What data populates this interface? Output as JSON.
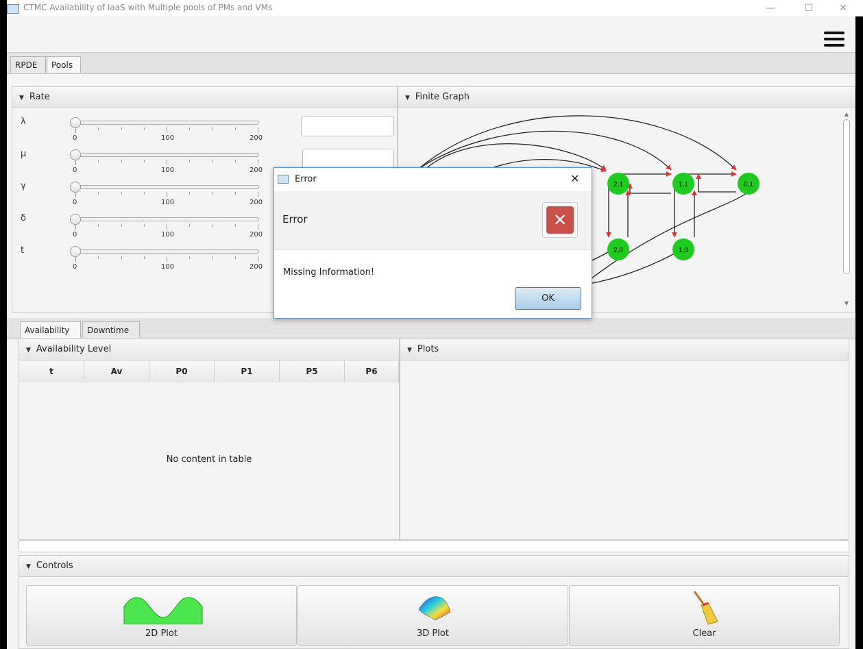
{
  "window": {
    "title": "CTMC Availability of IaaS with Multiple pools of PMs and VMs",
    "min_icon": "minimize-icon",
    "max_icon": "maximize-icon",
    "close_icon": "close-icon"
  },
  "menu": {
    "icon": "hamburger-menu-icon"
  },
  "top_tabs": [
    {
      "label": "RPDE",
      "selected": false
    },
    {
      "label": "Pools",
      "selected": true
    }
  ],
  "rate_panel": {
    "title": "Rate",
    "sliders": [
      {
        "symbol": "λ",
        "min": "0",
        "mid": "100",
        "max": "200",
        "value": 0
      },
      {
        "symbol": "μ",
        "min": "0",
        "mid": "100",
        "max": "200",
        "value": 0
      },
      {
        "symbol": "γ",
        "min": "0",
        "mid": "100",
        "max": "200",
        "value": 0
      },
      {
        "symbol": "δ",
        "min": "0",
        "mid": "100",
        "max": "200",
        "value": 0
      },
      {
        "symbol": "t",
        "min": "0",
        "mid": "100",
        "max": "200",
        "value": 0
      }
    ]
  },
  "graph_panel": {
    "title": "Finite Graph",
    "nodes": [
      {
        "label": "2,1"
      },
      {
        "label": "1,1"
      },
      {
        "label": "0,1"
      },
      {
        "label": "2,0"
      },
      {
        "label": "1,0"
      }
    ]
  },
  "bottom_tabs": [
    {
      "label": "Availability",
      "selected": true
    },
    {
      "label": "Downtime",
      "selected": false
    }
  ],
  "availability_panel": {
    "title": "Availability Level",
    "columns": [
      "t",
      "Av",
      "P0",
      "P1",
      "P5",
      "P6"
    ],
    "empty_text": "No content in table"
  },
  "plots_panel": {
    "title": "Plots"
  },
  "controls_panel": {
    "title": "Controls",
    "buttons": [
      {
        "label": "2D Plot",
        "icon": "2d-plot-icon"
      },
      {
        "label": "3D Plot",
        "icon": "3d-plot-icon"
      },
      {
        "label": "Clear",
        "icon": "broom-icon"
      }
    ]
  },
  "dialog": {
    "title": "Error",
    "header": "Error",
    "message": "Missing Information!",
    "ok_label": "OK",
    "close_glyph": "✕",
    "error_glyph": "✕",
    "colors": {
      "error_red": "#c9504a",
      "node_green": "#1ecb1e"
    }
  }
}
